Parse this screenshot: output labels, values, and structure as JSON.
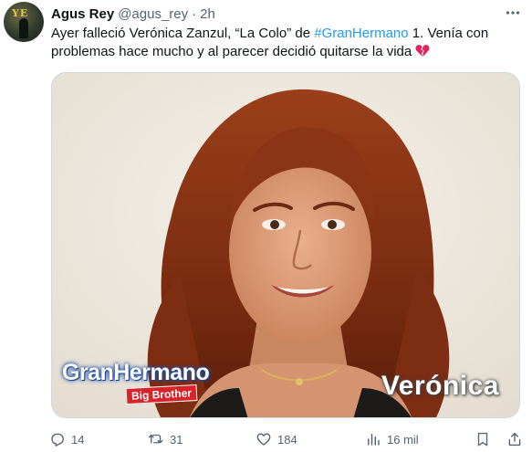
{
  "author": {
    "display_name": "Agus Rey",
    "handle": "@agus_rey",
    "separator": "·",
    "time": "2h",
    "avatar_text": "YE"
  },
  "tweet": {
    "text_before": "Ayer falleció Verónica Zanzul, “La Colo” de ",
    "hashtag": "#GranHermano",
    "text_after": " 1. Venía con problemas hace mucho y al parecer decidió quitarse la vida ",
    "emoji": "broken-heart"
  },
  "media": {
    "logo_text": "GranHermano",
    "badge_text": "Big Brother",
    "caption": "Verónica"
  },
  "actions": {
    "replies": "14",
    "retweets": "31",
    "likes": "184",
    "views": "16 mil"
  },
  "colors": {
    "accent": "#1d9bf0",
    "secondary_text": "#536471",
    "primary_text": "#0f1419",
    "heart": "#f91880"
  }
}
